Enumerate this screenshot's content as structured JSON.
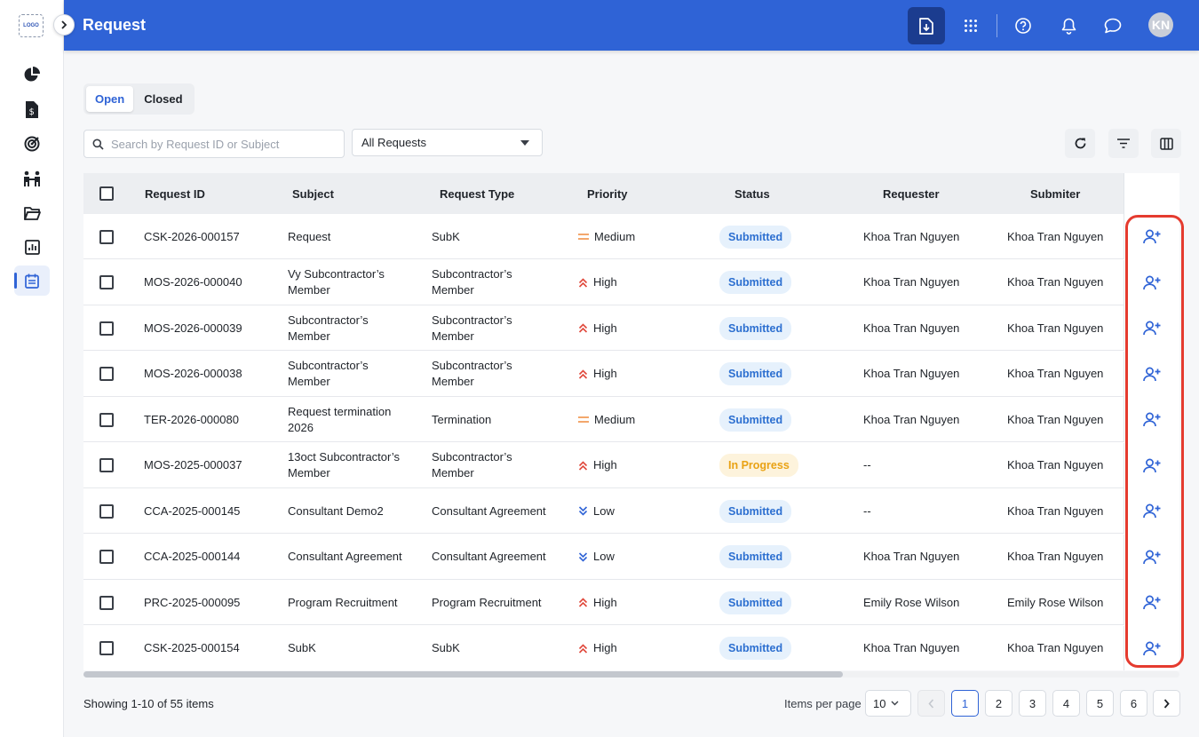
{
  "brand": {
    "logo_text": "LOGO",
    "accent": "#2f63d6",
    "highlight": "#e53b2f"
  },
  "header": {
    "title": "Request",
    "avatar_initials": "KN"
  },
  "tabs": [
    {
      "label": "Open"
    },
    {
      "label": "Closed"
    }
  ],
  "search": {
    "placeholder": "Search by Request ID or Subject",
    "value": ""
  },
  "filter": {
    "selected": "All Requests"
  },
  "table": {
    "columns": [
      "Request ID",
      "Subject",
      "Request Type",
      "Priority",
      "Status",
      "Requester",
      "Submiter"
    ],
    "rows": [
      {
        "id": "CSK-2026-000157",
        "subject": "Request",
        "type": "SubK",
        "priority": "Medium",
        "status": "Submitted",
        "requester": "Khoa Tran Nguyen",
        "submitter": "Khoa Tran Nguyen"
      },
      {
        "id": "MOS-2026-000040",
        "subject": "Vy Subcontractor’s Member",
        "type": "Subcontractor’s Member",
        "priority": "High",
        "status": "Submitted",
        "requester": "Khoa Tran Nguyen",
        "submitter": "Khoa Tran Nguyen"
      },
      {
        "id": "MOS-2026-000039",
        "subject": "Subcontractor’s Member",
        "type": "Subcontractor’s Member",
        "priority": "High",
        "status": "Submitted",
        "requester": "Khoa Tran Nguyen",
        "submitter": "Khoa Tran Nguyen"
      },
      {
        "id": "MOS-2026-000038",
        "subject": "Subcontractor’s Member",
        "type": "Subcontractor’s Member",
        "priority": "High",
        "status": "Submitted",
        "requester": "Khoa Tran Nguyen",
        "submitter": "Khoa Tran Nguyen"
      },
      {
        "id": "TER-2026-000080",
        "subject": "Request termination 2026",
        "type": "Termination",
        "priority": "Medium",
        "status": "Submitted",
        "requester": "Khoa Tran Nguyen",
        "submitter": "Khoa Tran Nguyen"
      },
      {
        "id": "MOS-2025-000037",
        "subject": "13oct Subcontractor’s Member",
        "type": "Subcontractor’s Member",
        "priority": "High",
        "status": "In Progress",
        "requester": "--",
        "submitter": "Khoa Tran Nguyen"
      },
      {
        "id": "CCA-2025-000145",
        "subject": "Consultant Demo2",
        "type": "Consultant Agreement",
        "priority": "Low",
        "status": "Submitted",
        "requester": "--",
        "submitter": "Khoa Tran Nguyen"
      },
      {
        "id": "CCA-2025-000144",
        "subject": "Consultant Agreement",
        "type": "Consultant Agreement",
        "priority": "Low",
        "status": "Submitted",
        "requester": "Khoa Tran Nguyen",
        "submitter": "Khoa Tran Nguyen"
      },
      {
        "id": "PRC-2025-000095",
        "subject": "Program Recruitment",
        "type": "Program Recruitment",
        "priority": "High",
        "status": "Submitted",
        "requester": "Emily Rose Wilson",
        "submitter": "Emily Rose Wilson"
      },
      {
        "id": "CSK-2025-000154",
        "subject": "SubK",
        "type": "SubK",
        "priority": "High",
        "status": "Submitted",
        "requester": "Khoa Tran Nguyen",
        "submitter": "Khoa Tran Nguyen"
      }
    ]
  },
  "footer": {
    "showing": "Showing 1-10 of 55 items",
    "items_per_page_label": "Items per page",
    "items_per_page": "10",
    "pages": [
      "1",
      "2",
      "3",
      "4",
      "5",
      "6"
    ],
    "current_page": "1"
  }
}
